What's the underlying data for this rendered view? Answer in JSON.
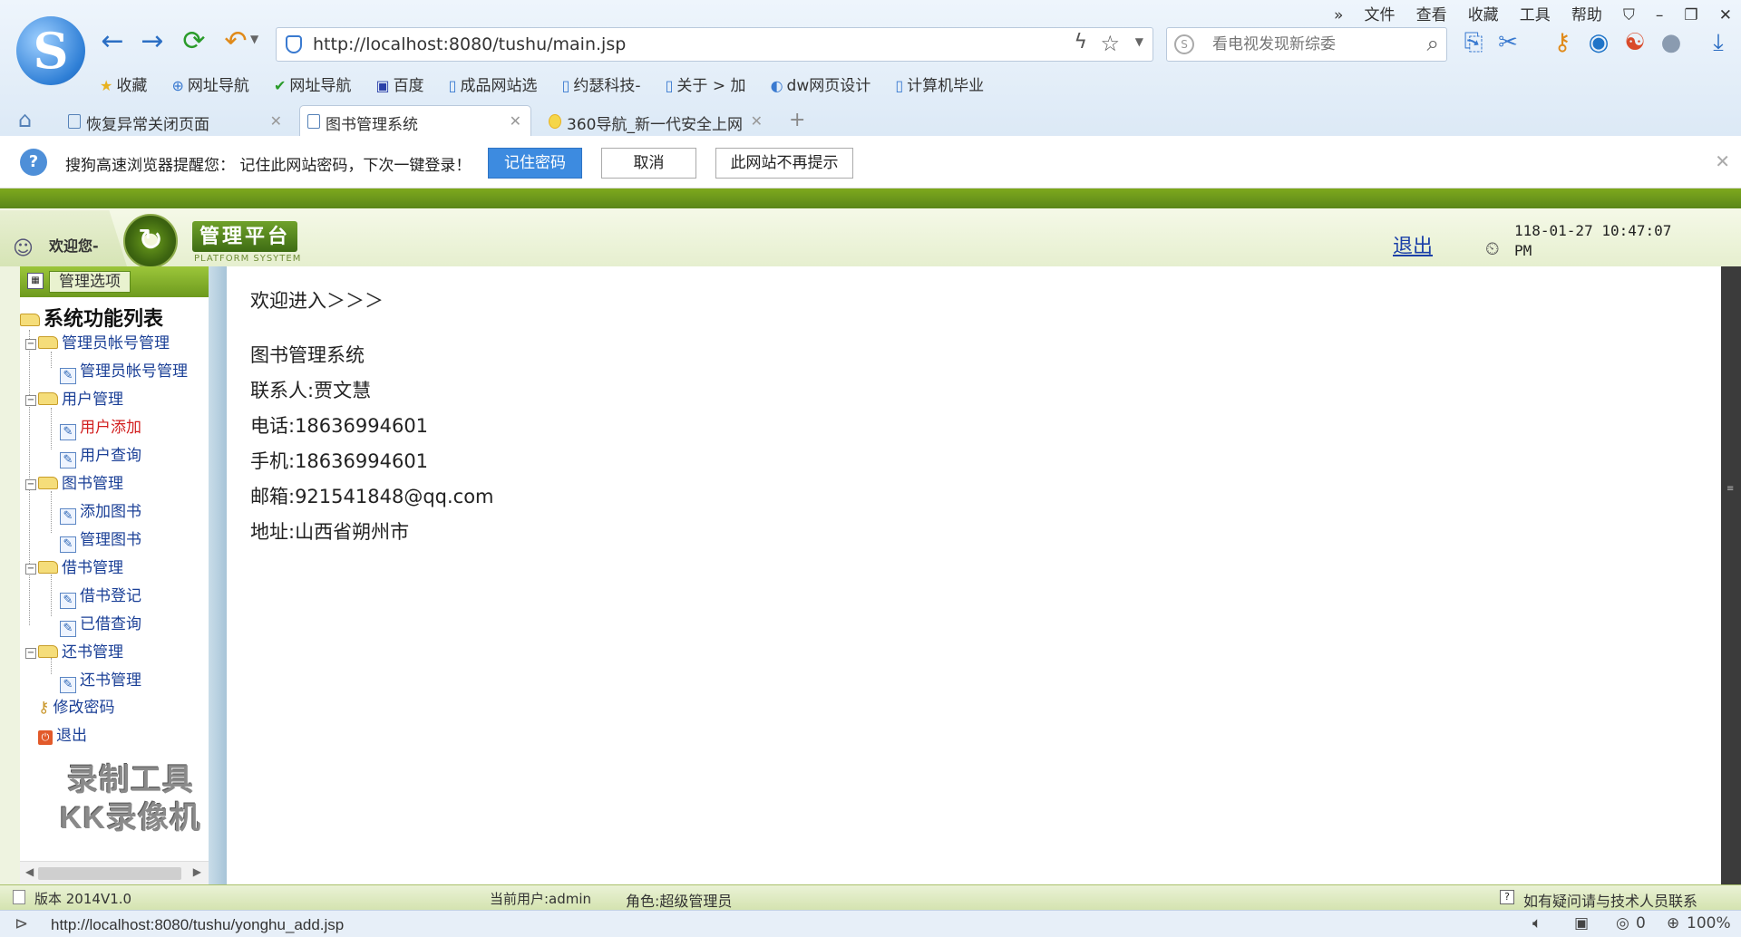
{
  "browser": {
    "url": "http://localhost:8080/tushu/main.jsp",
    "search_placeholder": "看电视发现新综委",
    "menu": [
      "»",
      "文件",
      "查看",
      "收藏",
      "工具",
      "帮助"
    ],
    "bookmarks": [
      {
        "label": "收藏",
        "icon": "star-icon"
      },
      {
        "label": "网址导航",
        "icon": "globe-icon"
      },
      {
        "label": "网址导航",
        "icon": "check-icon"
      },
      {
        "label": "百度",
        "icon": "paw-icon"
      },
      {
        "label": "成品网站选",
        "icon": "page-icon"
      },
      {
        "label": "约瑟科技-",
        "icon": "page-icon"
      },
      {
        "label": "关于 > 加",
        "icon": "page-icon"
      },
      {
        "label": "dw网页设计",
        "icon": "page-icon"
      },
      {
        "label": "计算机毕业",
        "icon": "page-icon"
      }
    ],
    "tabs": [
      {
        "label": "恢复异常关闭页面"
      },
      {
        "label": "图书管理系统"
      },
      {
        "label": "360导航_新一代安全上网"
      }
    ],
    "status_url": "http://localhost:8080/tushu/yonghu_add.jsp",
    "status_counter": "0",
    "zoom": "100%"
  },
  "infobar": {
    "message": "搜狗高速浏览器提醒您：  记住此网站密码，下次一键登录！",
    "remember_label": "记住密码",
    "cancel_label": "取消",
    "never_label": "此网站不再提示"
  },
  "header": {
    "welcome": "欢迎您-",
    "platform_title": "管理平台",
    "platform_subtitle": "PLATFORM SYSYTEM",
    "logout": "退出",
    "datetime_line1": "118-01-27 10:47:07",
    "datetime_line2": "PM"
  },
  "sidebar": {
    "header_label": "管理选项",
    "root": "系统功能列表",
    "groups": [
      {
        "label": "管理员帐号管理",
        "items": [
          "管理员帐号管理"
        ]
      },
      {
        "label": "用户管理",
        "items": [
          "用户添加",
          "用户查询"
        ]
      },
      {
        "label": "图书管理",
        "items": [
          "添加图书",
          "管理图书"
        ]
      },
      {
        "label": "借书管理",
        "items": [
          "借书登记",
          "已借查询"
        ]
      },
      {
        "label": "还书管理",
        "items": [
          "还书管理"
        ]
      }
    ],
    "change_password": "修改密码",
    "logout": "退出",
    "watermark_line1": "录制工具",
    "watermark_line2": "KK录像机"
  },
  "main": {
    "welcome": "欢迎进入＞＞＞",
    "system_name": "图书管理系统",
    "contact": "联系人:贾文慧",
    "phone": "电话:18636994601",
    "mobile": "手机:18636994601",
    "email": "邮箱:921541848@qq.com",
    "address": "地址:山西省朔州市"
  },
  "footer": {
    "version": "版本 2014V1.0",
    "current_user": "当前用户:admin",
    "role": "角色:超级管理员",
    "help": "如有疑问请与技术人员联系"
  }
}
